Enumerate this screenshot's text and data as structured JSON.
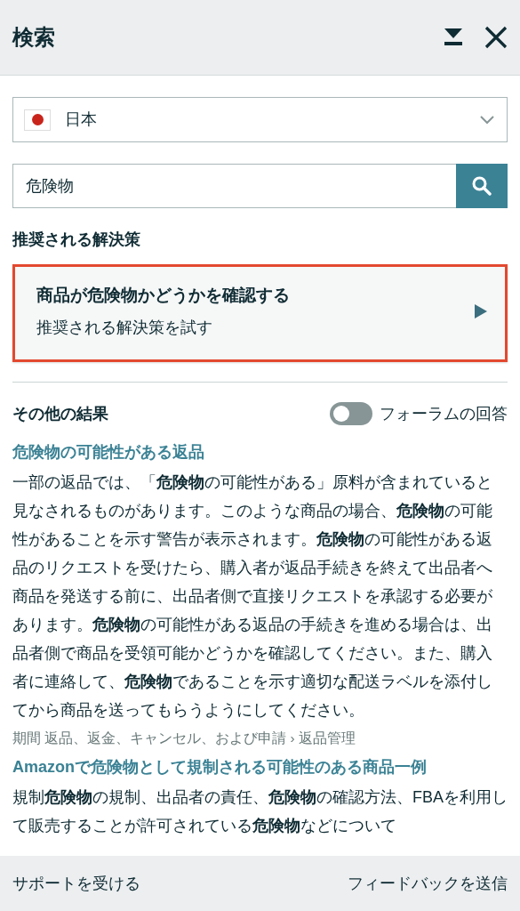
{
  "header": {
    "title": "検索"
  },
  "country_select": {
    "value": "日本"
  },
  "search": {
    "value": "危険物"
  },
  "recommended": {
    "heading": "推奨される解決策",
    "card": {
      "title": "商品が危険物かどうかを確認する",
      "subtitle": "推奨される解決策を試す",
      "selected": true
    }
  },
  "other_results": {
    "heading": "その他の結果",
    "toggle": {
      "label": "フォーラムの回答",
      "on": false
    }
  },
  "results": [
    {
      "title": "危険物の可能性がある返品",
      "snippet": "一部の返品では、「**危険物**の可能性がある」原料が含まれていると見なされるものがあります。このような商品の場合、**危険物**の可能性があることを示す警告が表示されます。**危険物**の可能性がある返品のリクエストを受けたら、購入者が返品手続きを終えて出品者へ商品を発送する前に、出品者側で直接リクエストを承認する必要があります。**危険物**の可能性がある返品の手続きを進める場合は、出品者側で商品を受領可能かどうかを確認してください。また、購入者に連絡して、**危険物**であることを示す適切な配送ラベルを添付してから商品を送ってもらうようにしてください。",
      "breadcrumb": "期間 返品、返金、キャンセル、および申請 › 返品管理"
    },
    {
      "title": "Amazonで危険物として規制される可能性のある商品一例",
      "snippet": "規制**危険物**の規制、出品者の責任、**危険物**の確認方法、FBAを利用して販売することが許可されている**危険物**などについて"
    }
  ],
  "footer": {
    "left": "サポートを受ける",
    "right": "フィードバックを送信"
  }
}
